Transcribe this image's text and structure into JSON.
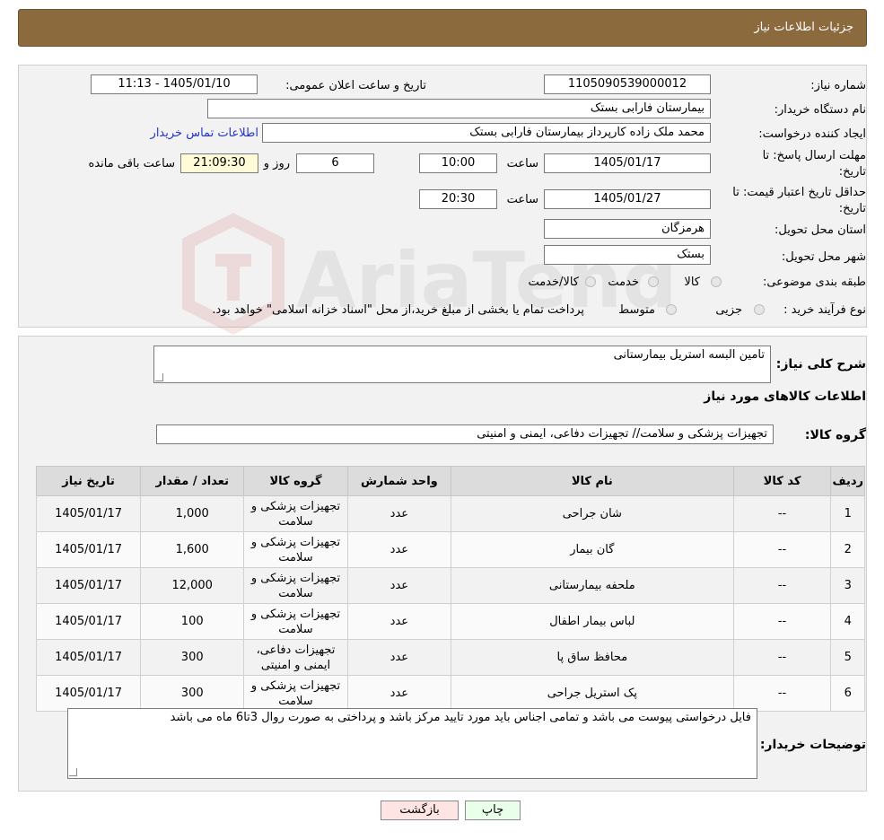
{
  "header": {
    "title": "جزئیات اطلاعات نیاز"
  },
  "form": {
    "need_number_label": "شماره نیاز:",
    "need_number": "1105090539000012",
    "announce_label": "تاریخ و ساعت اعلان عمومی:",
    "announce_value": "1405/01/10 - 11:13",
    "buyer_org_label": "نام دستگاه خریدار:",
    "buyer_org": "بیمارستان فارابی بستک",
    "creator_label": "ایجاد کننده درخواست:",
    "creator": "محمد ملک زاده کارپرداز بیمارستان فارابی بستک",
    "contact_link": "اطلاعات تماس خریدار",
    "deadline_label_1": "مهلت ارسال پاسخ: تا",
    "deadline_label_2": "تاریخ:",
    "deadline_date": "1405/01/17",
    "time_label": "ساعت",
    "deadline_time": "10:00",
    "days_value": "6",
    "days_label": "روز و",
    "remaining_value": "21:09:30",
    "remaining_label": "ساعت باقی مانده",
    "validity_label_1": "حداقل تاریخ اعتبار قیمت: تا",
    "validity_label_2": "تاریخ:",
    "validity_date": "1405/01/27",
    "validity_time": "20:30",
    "province_label": "استان محل تحویل:",
    "province": "هرمزگان",
    "city_label": "شهر محل تحویل:",
    "city": "بستک",
    "category_label": "طبقه بندی موضوعی:",
    "category_options": [
      "کالا",
      "خدمت",
      "کالا/خدمت"
    ],
    "process_label": "نوع فرآیند خرید :",
    "process_options": [
      "جزیی",
      "متوسط"
    ],
    "process_note": "پرداخت تمام یا بخشی از مبلغ خرید،از محل \"اسناد خزانه اسلامی\" خواهد بود."
  },
  "description": {
    "label": "شرح کلی نیاز:",
    "value": "تامین البسه استریل بیمارستانی",
    "goods_info_title": "اطلاعات کالاهای مورد نیاز",
    "group_label": "گروه کالا:",
    "group_value": "تجهیزات پزشکی و سلامت// تجهیزات دفاعی، ایمنی و امنیتی"
  },
  "table": {
    "headers": [
      "ردیف",
      "کد کالا",
      "نام کالا",
      "واحد شمارش",
      "گروه کالا",
      "تعداد / مقدار",
      "تاریخ نیاز"
    ],
    "rows": [
      [
        "1",
        "--",
        "شان جراحی",
        "عدد",
        "تجهیزات پزشکی و سلامت",
        "1,000",
        "1405/01/17"
      ],
      [
        "2",
        "--",
        "گان بیمار",
        "عدد",
        "تجهیزات پزشکی و سلامت",
        "1,600",
        "1405/01/17"
      ],
      [
        "3",
        "--",
        "ملحفه بیمارستانی",
        "عدد",
        "تجهیزات پزشکی و سلامت",
        "12,000",
        "1405/01/17"
      ],
      [
        "4",
        "--",
        "لباس بیمار اطفال",
        "عدد",
        "تجهیزات پزشکی و سلامت",
        "100",
        "1405/01/17"
      ],
      [
        "5",
        "--",
        "محافظ ساق پا",
        "عدد",
        "تجهیزات دفاعی، ایمنی و امنیتی",
        "300",
        "1405/01/17"
      ],
      [
        "6",
        "--",
        "پک استریل جراحی",
        "عدد",
        "تجهیزات پزشکی و سلامت",
        "300",
        "1405/01/17"
      ]
    ]
  },
  "buyer_notes": {
    "label": "توضیحات خریدار:",
    "value": "فایل درخواستی پیوست می باشد و تمامی اجناس باید مورد تایید مرکز باشد و پرداختی به صورت روال 3تا6 ماه می باشد"
  },
  "buttons": {
    "print": "چاپ",
    "back": "بازگشت"
  },
  "watermark": {
    "text": "AriaTender.neT"
  },
  "colors": {
    "header_bg": "#8b6a3e",
    "link": "#2233cc",
    "back_bg": "#ffe4e4",
    "print_bg": "#eaffea"
  }
}
